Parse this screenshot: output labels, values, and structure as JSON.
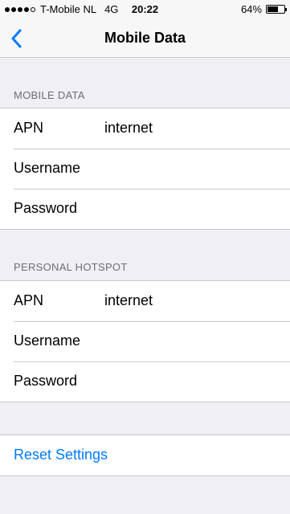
{
  "status_bar": {
    "carrier": "T-Mobile NL",
    "network": "4G",
    "time": "20:22",
    "battery_percent_label": "64%",
    "battery_level": 0.64,
    "signal_bars": 4,
    "signal_max": 5
  },
  "nav": {
    "title": "Mobile Data",
    "back_icon": "chevron-left-icon"
  },
  "mobile_data": {
    "header": "MOBILE DATA",
    "rows": [
      {
        "label": "APN",
        "value": "internet"
      },
      {
        "label": "Username",
        "value": ""
      },
      {
        "label": "Password",
        "value": ""
      }
    ]
  },
  "personal_hotspot": {
    "header": "PERSONAL HOTSPOT",
    "rows": [
      {
        "label": "APN",
        "value": "internet"
      },
      {
        "label": "Username",
        "value": ""
      },
      {
        "label": "Password",
        "value": ""
      }
    ]
  },
  "reset": {
    "label": "Reset Settings"
  },
  "colors": {
    "accent": "#007aff",
    "background": "#efeff4",
    "separator": "#c8c7cc",
    "header_text": "#6d6d72"
  }
}
